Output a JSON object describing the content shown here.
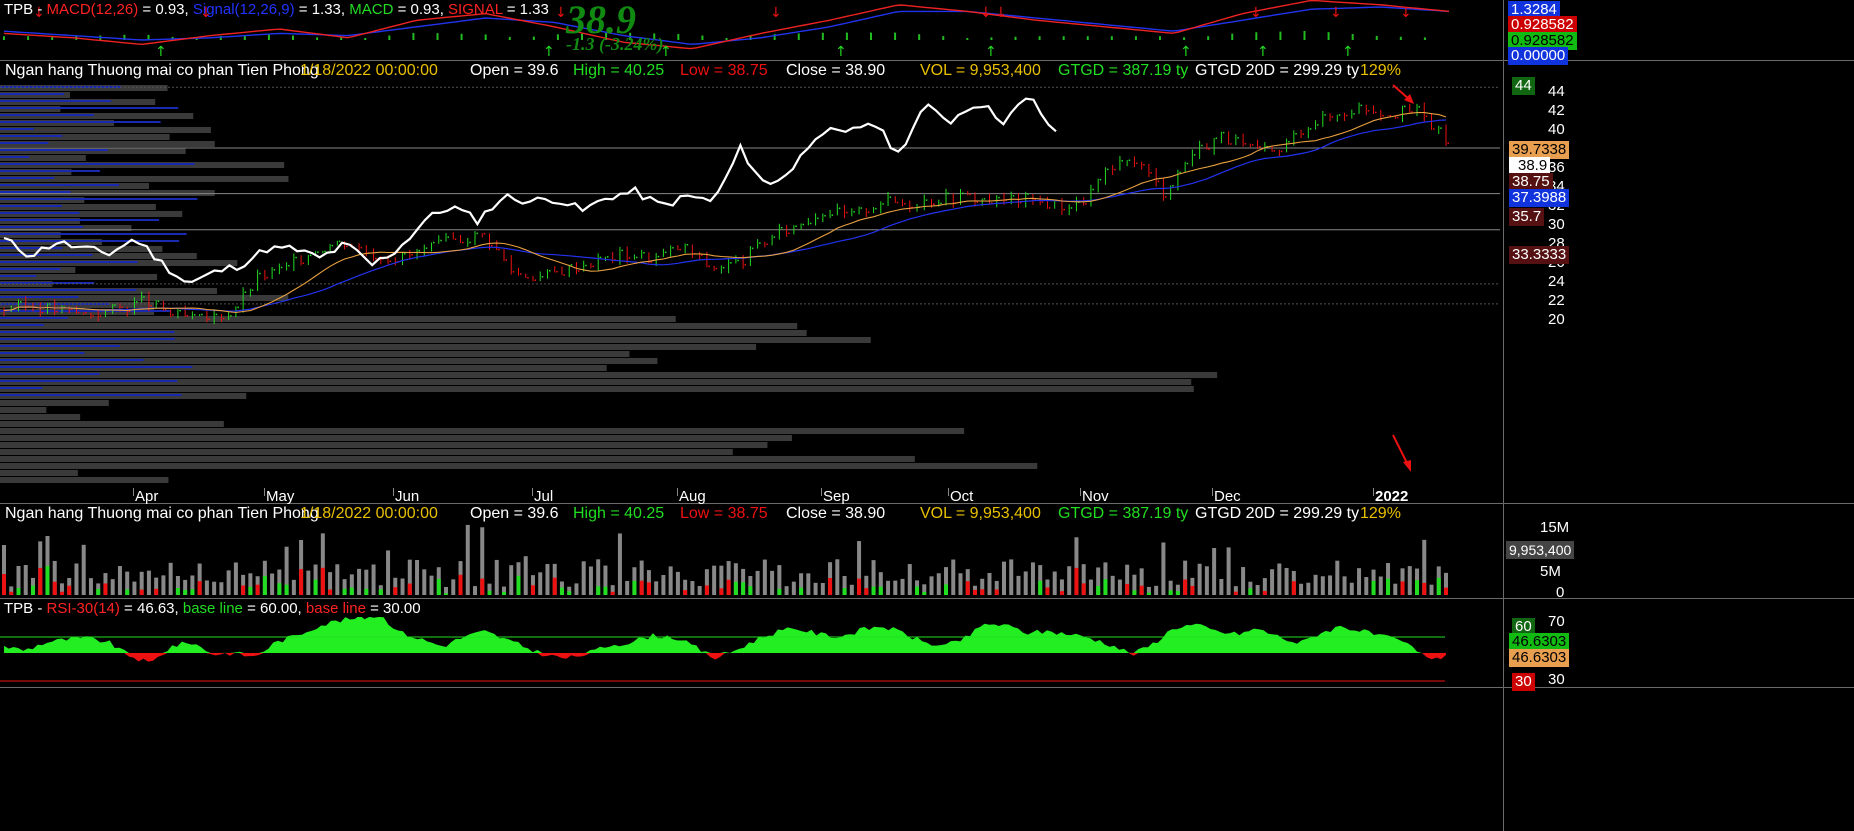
{
  "macd_header": {
    "symbol": "TPB -",
    "macd_label": "MACD(12,26)",
    "macd_val": "= 0.93,",
    "signal_label": "Signal(12,26,9)",
    "signal_val": "= 1.33,",
    "macd2_label": "MACD",
    "macd2_val": "= 0.93,",
    "signal2_label": "SIGNAL",
    "signal2_val": "= 1.33"
  },
  "overlay": {
    "price": "38.9",
    "change": "-1.3 (-3.24%)"
  },
  "macd_tags": [
    "1.3284",
    "0.928582",
    "0.928582",
    "0.00000"
  ],
  "info": {
    "name": "Ngan hang Thuong mai co phan Tien Phong",
    "date": "1/18/2022 00:00:00",
    "open": "Open = 39.6",
    "high": "High = 40.25",
    "low": "Low = 38.75",
    "close": "Close = 38.90",
    "vol": "VOL = 9,953,400",
    "gtgd": "GTGD = 387.19  ty",
    "gtgd20": "GTGD 20D = 299.29  ty",
    "pct": "129%"
  },
  "price_axis": [
    "44",
    "42",
    "40",
    "38",
    "36",
    "34",
    "32",
    "30",
    "28",
    "26",
    "24",
    "22",
    "20"
  ],
  "price_tags": {
    "t44": "44",
    "ma_fast": "39.7338",
    "close": "38.9",
    "low": "38.75",
    "ma_slow": "37.3988",
    "support": "35.7",
    "level": "33.3333"
  },
  "months": [
    "Apr",
    "May",
    "Jun",
    "Jul",
    "Aug",
    "Sep",
    "Oct",
    "Nov",
    "Dec",
    "2022"
  ],
  "volume_axis": [
    "15M",
    "10M",
    "5M",
    "0"
  ],
  "volume_tag": "9,953,400",
  "rsi_header": {
    "symbol": "TPB -",
    "rsi": "RSI-30(14)",
    "rsi_val": "= 46.63,",
    "base1": "base line",
    "base1_val": "= 60.00,",
    "base2": "base line",
    "base2_val": "= 30.00"
  },
  "rsi_axis": [
    "70",
    "50",
    "30"
  ],
  "rsi_tags": {
    "b60": "60",
    "v1": "46.6303",
    "v2": "46.6303",
    "b30": "30"
  },
  "colors": {
    "up": "#22dd22",
    "down": "#ee1111",
    "ma_fast": "#e8a040",
    "ma_slow": "#2233ee",
    "tag_blue": "#1133dd"
  },
  "chart_data": [
    {
      "type": "line",
      "title": "MACD(12,26)",
      "series": [
        {
          "name": "MACD",
          "values": [
            0.3,
            0.1,
            -0.2,
            0.2,
            0.5,
            0.1,
            0.9,
            1.2,
            0.6,
            -0.1,
            -0.4,
            0.3,
            0.9,
            1.6,
            1.3,
            0.9,
            0.6,
            0.3,
            1.2,
            1.8,
            1.6,
            1.3
          ]
        },
        {
          "name": "Signal(12,26,9)",
          "values": [
            0.4,
            0.2,
            0.0,
            0.1,
            0.3,
            0.2,
            0.6,
            1.0,
            0.8,
            0.2,
            -0.2,
            0.1,
            0.6,
            1.3,
            1.3,
            1.0,
            0.7,
            0.4,
            0.9,
            1.4,
            1.5,
            1.3
          ]
        }
      ]
    },
    {
      "type": "candlestick",
      "categories": [
        "Apr",
        "May",
        "Jun",
        "Jul",
        "Aug",
        "Sep",
        "Oct",
        "Nov",
        "Dec",
        "2022"
      ],
      "ylim": [
        19,
        45
      ],
      "ohlc_close_path": [
        21.2,
        21.5,
        21.0,
        20.6,
        21.2,
        22.0,
        20.5,
        20.0,
        20.8,
        24.5,
        25.5,
        27.5,
        28.3,
        27.0,
        26.5,
        27.5,
        28.5,
        29.0,
        25.0,
        24.5,
        25.5,
        26.3,
        27.0,
        26.5,
        27.8,
        25.5,
        26.0,
        28.5,
        30.0,
        31.5,
        31.0,
        32.5,
        32.3,
        32.8,
        33.0,
        32.5,
        32.8,
        32.2,
        32.0,
        35.5,
        37.0,
        33.5,
        37.5,
        39.5,
        38.0,
        37.5,
        40.5,
        41.5,
        42.5,
        41.8,
        42.0,
        38.9
      ],
      "series": [
        {
          "name": "MA fast",
          "last": 39.7338
        },
        {
          "name": "MA slow",
          "last": 37.3988
        }
      ]
    },
    {
      "type": "bar",
      "title": "VOL",
      "ylim": [
        0,
        17
      ],
      "last": 9953400
    },
    {
      "type": "area",
      "title": "RSI-30(14)",
      "ylim": [
        25,
        85
      ],
      "base_lines": [
        60,
        30
      ],
      "values": [
        55,
        52,
        58,
        60,
        61,
        58,
        48,
        42,
        55,
        58,
        49,
        50,
        47,
        58,
        63,
        70,
        74,
        76,
        78,
        65,
        60,
        55,
        62,
        66,
        60,
        54,
        48,
        46,
        50,
        56,
        58,
        63,
        62,
        55,
        46,
        52,
        60,
        66,
        68,
        64,
        62,
        67,
        70,
        65,
        58,
        55,
        61,
        72,
        70,
        65,
        66,
        64,
        61,
        56,
        49,
        57,
        69,
        71,
        66,
        64,
        68,
        62,
        57,
        65,
        70,
        66,
        62,
        58,
        47,
        46.63
      ],
      "last": 46.63
    }
  ]
}
